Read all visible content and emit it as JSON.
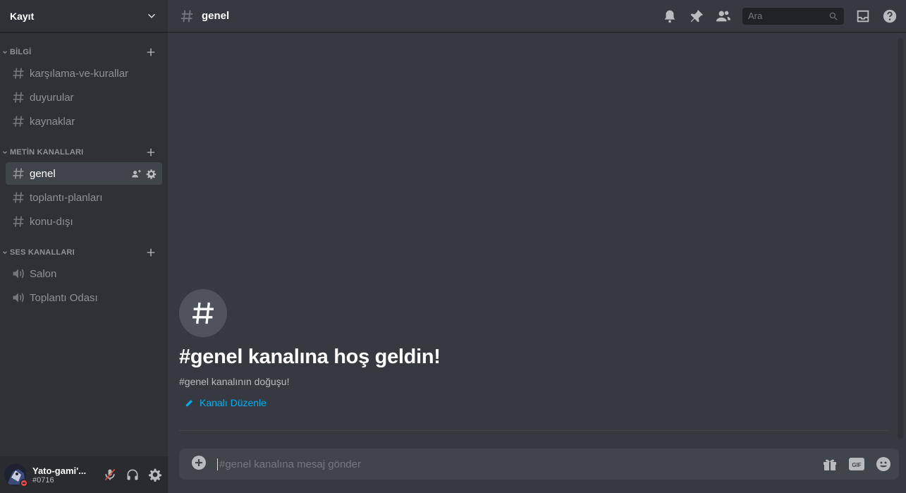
{
  "server": {
    "name": "Kayıt"
  },
  "categories": [
    {
      "label": "BİLGİ",
      "channels": [
        {
          "name": "karşılama-ve-kurallar",
          "type": "text"
        },
        {
          "name": "duyurular",
          "type": "text"
        },
        {
          "name": "kaynaklar",
          "type": "text"
        }
      ]
    },
    {
      "label": "METİN KANALLARI",
      "channels": [
        {
          "name": "genel",
          "type": "text",
          "active": true
        },
        {
          "name": "toplantı-planları",
          "type": "text"
        },
        {
          "name": "konu-dışı",
          "type": "text"
        }
      ]
    },
    {
      "label": "SES KANALLARI",
      "channels": [
        {
          "name": "Salon",
          "type": "voice"
        },
        {
          "name": "Toplantı Odası",
          "type": "voice"
        }
      ]
    }
  ],
  "user": {
    "name": "Yato-gami'...",
    "tag": "#0716",
    "status": "dnd"
  },
  "topbar": {
    "channel": "genel",
    "search_placeholder": "Ara"
  },
  "welcome": {
    "title": "#genel kanalına hoş geldin!",
    "subtitle": "#genel kanalının doğuşu!",
    "edit_label": "Kanalı Düzenle"
  },
  "composer": {
    "placeholder": "#genel kanalına mesaj gönder"
  },
  "colors": {
    "accent": "#00b0f4",
    "dnd": "#f04747",
    "sidebar": "#2f3136",
    "main": "#36393f"
  }
}
